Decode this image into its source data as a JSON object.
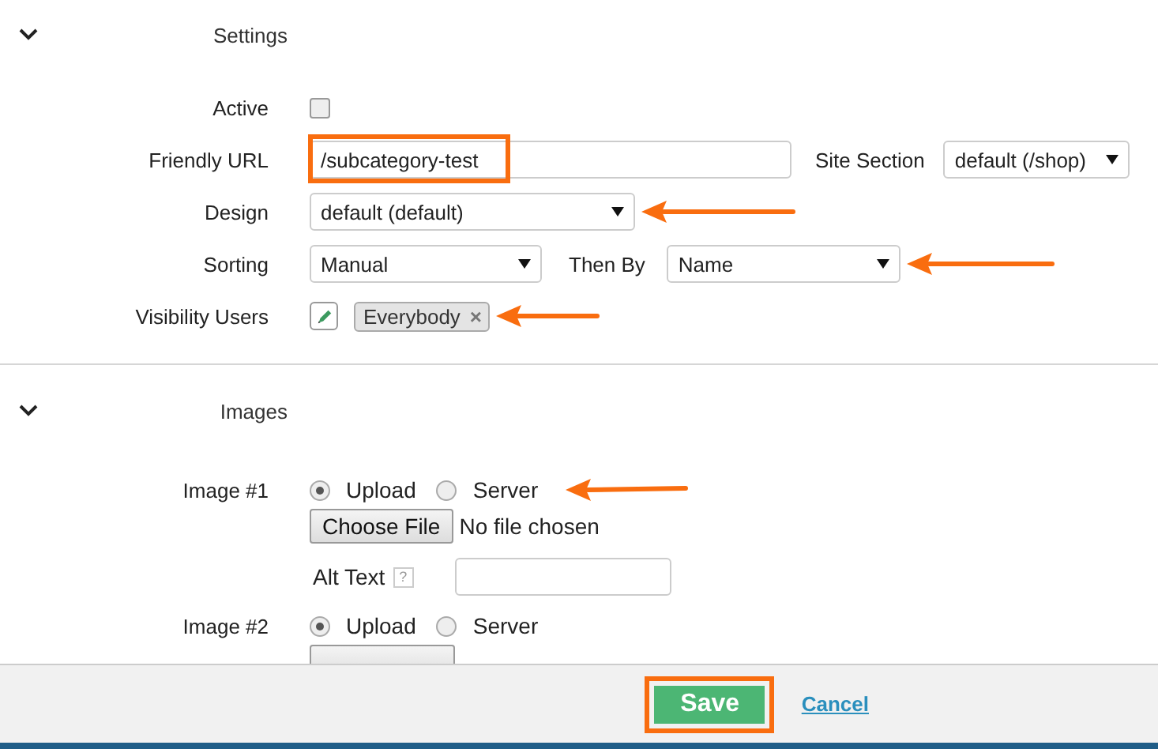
{
  "settings": {
    "title": "Settings",
    "expanded": true,
    "active": {
      "label": "Active",
      "checked": false
    },
    "friendly_url": {
      "label": "Friendly URL",
      "value": "/subcategory-test",
      "highlighted": true
    },
    "site_section": {
      "label": "Site Section",
      "value": "default (/shop)"
    },
    "design": {
      "label": "Design",
      "value": "default (default)",
      "arrow": true
    },
    "sorting": {
      "label": "Sorting",
      "value": "Manual"
    },
    "then_by": {
      "label": "Then By",
      "value": "Name",
      "arrow": true
    },
    "visibility": {
      "label": "Visibility Users",
      "tags": [
        {
          "label": "Everybody",
          "remove": "×"
        }
      ],
      "arrow": true
    }
  },
  "images": {
    "title": "Images",
    "expanded": true,
    "items": [
      {
        "label": "Image #1",
        "arrow": true,
        "options": [
          {
            "label": "Upload",
            "selected": true
          },
          {
            "label": "Server",
            "selected": false
          }
        ],
        "file_button": "Choose File",
        "file_status": "No file chosen",
        "alt_label": "Alt Text",
        "help": "?"
      },
      {
        "label": "Image #2",
        "arrow": false,
        "options": [
          {
            "label": "Upload",
            "selected": true
          },
          {
            "label": "Server",
            "selected": false
          }
        ]
      }
    ]
  },
  "footer": {
    "save": "Save",
    "save_highlighted": true,
    "cancel": "Cancel"
  }
}
